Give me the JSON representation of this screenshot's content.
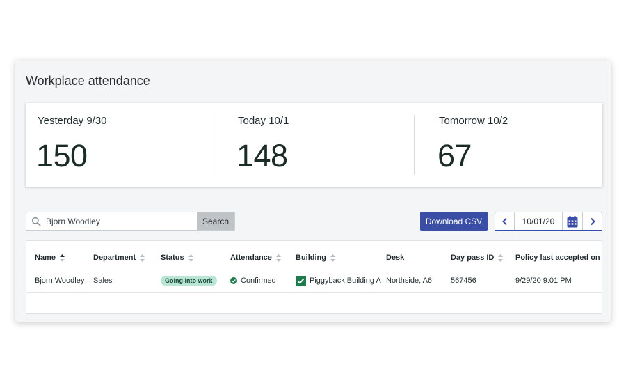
{
  "page": {
    "title": "Workplace attendance"
  },
  "stats": [
    {
      "label": "Yesterday 9/30",
      "value": "150"
    },
    {
      "label": "Today 10/1",
      "value": "148"
    },
    {
      "label": "Tomorrow 10/2",
      "value": "67"
    }
  ],
  "search": {
    "value": "Bjorn Woodley",
    "placeholder": "Search",
    "button_label": "Search"
  },
  "toolbar": {
    "download_label": "Download CSV"
  },
  "date_nav": {
    "value": "10/01/20"
  },
  "table": {
    "columns": [
      "Name",
      "Department",
      "Status",
      "Attendance",
      "Building",
      "Desk",
      "Day pass ID",
      "Policy last accepted on"
    ],
    "rows": [
      {
        "name": "Bjorn Woodley",
        "department": "Sales",
        "status": "Going into work",
        "attendance": "Confirmed",
        "building": "Piggyback Building A",
        "desk": "Northside, A6",
        "day_pass_id": "567456",
        "policy_accepted": "9/29/20 9:01 PM"
      }
    ]
  },
  "colors": {
    "accent": "#3a4ea5",
    "status_badge": "#b9e6d4",
    "confirmed": "#1f7a4d",
    "building_icon": "#1f7a4d"
  },
  "icons": {
    "search": "search-icon",
    "prev": "chevron-left-icon",
    "next": "chevron-right-icon",
    "calendar": "calendar-icon",
    "confirmed": "check-circle-icon",
    "building": "checkbox-icon"
  }
}
